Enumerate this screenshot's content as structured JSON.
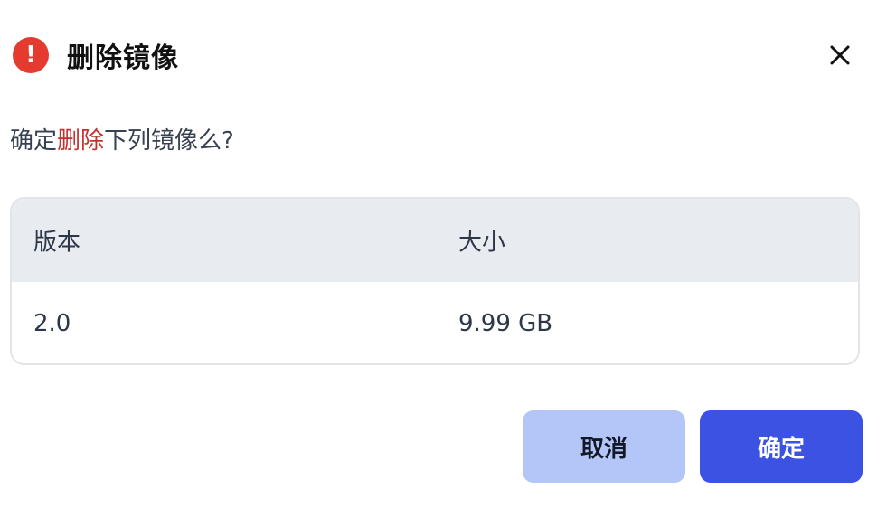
{
  "dialog": {
    "title": "删除镜像",
    "warning_icon": "exclamation-circle-icon",
    "close_icon": "close-icon",
    "message": {
      "prefix": "确定",
      "emphasis": "删除",
      "suffix": "下列镜像么?"
    },
    "colors": {
      "danger": "#e53a2f",
      "emphasis_text": "#c53030",
      "primary": "#3b52e2",
      "secondary": "#b4c6f8"
    }
  },
  "table": {
    "headers": [
      "版本",
      "大小"
    ],
    "rows": [
      [
        "2.0",
        "9.99 GB"
      ]
    ]
  },
  "actions": {
    "cancel_label": "取消",
    "confirm_label": "确定"
  }
}
